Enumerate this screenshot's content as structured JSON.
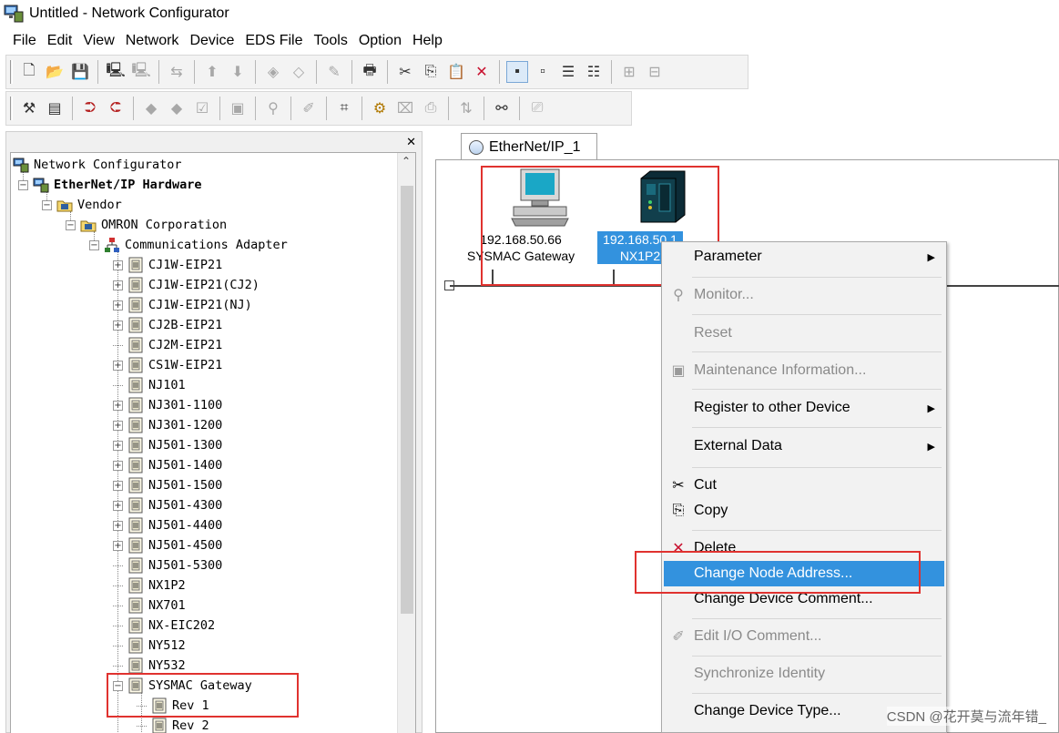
{
  "window": {
    "title": "Untitled - Network Configurator"
  },
  "menubar": [
    "File",
    "Edit",
    "View",
    "Network",
    "Device",
    "EDS File",
    "Tools",
    "Option",
    "Help"
  ],
  "tree": {
    "root": "Network Configurator",
    "hardware": "EtherNet/IP Hardware",
    "vendor": "Vendor",
    "company": "OMRON Corporation",
    "category": "Communications Adapter",
    "devices": [
      "CJ1W-EIP21",
      "CJ1W-EIP21(CJ2)",
      "CJ1W-EIP21(NJ)",
      "CJ2B-EIP21",
      "CJ2M-EIP21",
      "CS1W-EIP21",
      "NJ101",
      "NJ301-1100",
      "NJ301-1200",
      "NJ501-1300",
      "NJ501-1400",
      "NJ501-1500",
      "NJ501-4300",
      "NJ501-4400",
      "NJ501-4500",
      "NJ501-5300",
      "NX1P2",
      "NX701",
      "NX-EIC202",
      "NY512",
      "NY532",
      "SYSMAC Gateway"
    ],
    "revisions": [
      "Rev 1",
      "Rev 2"
    ]
  },
  "tab": {
    "label": "EtherNet/IP_1"
  },
  "nodes": [
    {
      "ip": "192.168.50.66",
      "name": "SYSMAC Gateway"
    },
    {
      "ip": "192.168.50.1",
      "name": "NX1P2"
    }
  ],
  "context_menu": {
    "items": [
      {
        "label": "Parameter",
        "submenu": true
      },
      {
        "label": "Monitor...",
        "disabled": true
      },
      {
        "label": "Reset",
        "disabled": true
      },
      {
        "label": "Maintenance Information...",
        "disabled": true
      },
      {
        "label": "Register to other Device",
        "submenu": true
      },
      {
        "label": "External Data",
        "submenu": true
      },
      {
        "label": "Cut"
      },
      {
        "label": "Copy"
      },
      {
        "label": "Delete"
      },
      {
        "label": "Change Node Address...",
        "highlighted": true
      },
      {
        "label": "Change Device Comment..."
      },
      {
        "label": "Edit I/O Comment...",
        "disabled": true
      },
      {
        "label": "Synchronize Identity",
        "disabled": true
      },
      {
        "label": "Change Device Type..."
      }
    ]
  },
  "watermark": "CSDN @花开莫与流年错_"
}
